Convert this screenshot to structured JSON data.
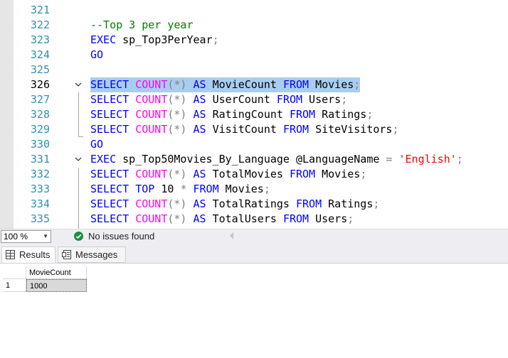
{
  "editor": {
    "lines": [
      {
        "number": "321",
        "tokens": []
      },
      {
        "number": "322",
        "tokens": [
          {
            "t": "--Top 3 per year",
            "k": "comment"
          }
        ]
      },
      {
        "number": "323",
        "tokens": [
          {
            "t": "EXEC",
            "k": "keyword"
          },
          {
            "t": " sp_Top3PerYear",
            "k": "plain"
          },
          {
            "t": ";",
            "k": "operator"
          }
        ]
      },
      {
        "number": "324",
        "tokens": [
          {
            "t": "GO",
            "k": "keyword"
          }
        ]
      },
      {
        "number": "325",
        "tokens": []
      },
      {
        "number": "326",
        "current": true,
        "highlight": true,
        "fold": "open",
        "tokens": [
          {
            "t": "SELECT",
            "k": "keyword"
          },
          {
            "t": " ",
            "k": "plain"
          },
          {
            "t": "COUNT",
            "k": "function"
          },
          {
            "t": "(*)",
            "k": "operator"
          },
          {
            "t": " ",
            "k": "plain"
          },
          {
            "t": "AS",
            "k": "keyword"
          },
          {
            "t": " MovieCount ",
            "k": "plain"
          },
          {
            "t": "FROM",
            "k": "keyword"
          },
          {
            "t": " Movies",
            "k": "plain"
          },
          {
            "t": ";",
            "k": "operator"
          }
        ]
      },
      {
        "number": "327",
        "tokens": [
          {
            "t": "SELECT",
            "k": "keyword"
          },
          {
            "t": " ",
            "k": "plain"
          },
          {
            "t": "COUNT",
            "k": "function"
          },
          {
            "t": "(*)",
            "k": "operator"
          },
          {
            "t": " ",
            "k": "plain"
          },
          {
            "t": "AS",
            "k": "keyword"
          },
          {
            "t": " UserCount ",
            "k": "plain"
          },
          {
            "t": "FROM",
            "k": "keyword"
          },
          {
            "t": " Users",
            "k": "plain"
          },
          {
            "t": ";",
            "k": "operator"
          }
        ]
      },
      {
        "number": "328",
        "tokens": [
          {
            "t": "SELECT",
            "k": "keyword"
          },
          {
            "t": " ",
            "k": "plain"
          },
          {
            "t": "COUNT",
            "k": "function"
          },
          {
            "t": "(*)",
            "k": "operator"
          },
          {
            "t": " ",
            "k": "plain"
          },
          {
            "t": "AS",
            "k": "keyword"
          },
          {
            "t": " RatingCount ",
            "k": "plain"
          },
          {
            "t": "FROM",
            "k": "keyword"
          },
          {
            "t": " Ratings",
            "k": "plain"
          },
          {
            "t": ";",
            "k": "operator"
          }
        ]
      },
      {
        "number": "329",
        "tokens": [
          {
            "t": "SELECT",
            "k": "keyword"
          },
          {
            "t": " ",
            "k": "plain"
          },
          {
            "t": "COUNT",
            "k": "function"
          },
          {
            "t": "(*)",
            "k": "operator"
          },
          {
            "t": " ",
            "k": "plain"
          },
          {
            "t": "AS",
            "k": "keyword"
          },
          {
            "t": " VisitCount ",
            "k": "plain"
          },
          {
            "t": "FROM",
            "k": "keyword"
          },
          {
            "t": " SiteVisitors",
            "k": "plain"
          },
          {
            "t": ";",
            "k": "operator"
          }
        ]
      },
      {
        "number": "330",
        "tokens": [
          {
            "t": "GO",
            "k": "keyword"
          }
        ]
      },
      {
        "number": "331",
        "fold": "open",
        "tokens": [
          {
            "t": "EXEC",
            "k": "keyword"
          },
          {
            "t": " sp_Top50Movies_By_Language @LanguageName ",
            "k": "plain"
          },
          {
            "t": "=",
            "k": "operator"
          },
          {
            "t": " ",
            "k": "plain"
          },
          {
            "t": "'English'",
            "k": "string"
          },
          {
            "t": ";",
            "k": "operator"
          }
        ]
      },
      {
        "number": "332",
        "tokens": [
          {
            "t": "SELECT",
            "k": "keyword"
          },
          {
            "t": " ",
            "k": "plain"
          },
          {
            "t": "COUNT",
            "k": "function"
          },
          {
            "t": "(*)",
            "k": "operator"
          },
          {
            "t": " ",
            "k": "plain"
          },
          {
            "t": "AS",
            "k": "keyword"
          },
          {
            "t": " TotalMovies ",
            "k": "plain"
          },
          {
            "t": "FROM",
            "k": "keyword"
          },
          {
            "t": " Movies",
            "k": "plain"
          },
          {
            "t": ";",
            "k": "operator"
          }
        ]
      },
      {
        "number": "333",
        "tokens": [
          {
            "t": "SELECT",
            "k": "keyword"
          },
          {
            "t": " ",
            "k": "plain"
          },
          {
            "t": "TOP",
            "k": "keyword"
          },
          {
            "t": " 10 ",
            "k": "plain"
          },
          {
            "t": "*",
            "k": "operator"
          },
          {
            "t": " ",
            "k": "plain"
          },
          {
            "t": "FROM",
            "k": "keyword"
          },
          {
            "t": " Movies",
            "k": "plain"
          },
          {
            "t": ";",
            "k": "operator"
          }
        ]
      },
      {
        "number": "334",
        "tokens": [
          {
            "t": "SELECT",
            "k": "keyword"
          },
          {
            "t": " ",
            "k": "plain"
          },
          {
            "t": "COUNT",
            "k": "function"
          },
          {
            "t": "(*)",
            "k": "operator"
          },
          {
            "t": " ",
            "k": "plain"
          },
          {
            "t": "AS",
            "k": "keyword"
          },
          {
            "t": " TotalRatings ",
            "k": "plain"
          },
          {
            "t": "FROM",
            "k": "keyword"
          },
          {
            "t": " Ratings",
            "k": "plain"
          },
          {
            "t": ";",
            "k": "operator"
          }
        ]
      },
      {
        "number": "335",
        "tokens": [
          {
            "t": "SELECT",
            "k": "keyword"
          },
          {
            "t": " ",
            "k": "plain"
          },
          {
            "t": "COUNT",
            "k": "function"
          },
          {
            "t": "(*)",
            "k": "operator"
          },
          {
            "t": " ",
            "k": "plain"
          },
          {
            "t": "AS",
            "k": "keyword"
          },
          {
            "t": " TotalUsers ",
            "k": "plain"
          },
          {
            "t": "FROM",
            "k": "keyword"
          },
          {
            "t": " Users",
            "k": "plain"
          },
          {
            "t": ";",
            "k": "operator"
          }
        ]
      }
    ]
  },
  "status_bar": {
    "zoom": "100 %",
    "issues_text": "No issues found",
    "issues_icon": "check-circle-icon",
    "issues_color": "#1e8e3e"
  },
  "results": {
    "tabs": [
      {
        "label": "Results",
        "icon": "grid-icon",
        "active": true
      },
      {
        "label": "Messages",
        "icon": "messages-icon",
        "active": false
      }
    ],
    "grid": {
      "columns": [
        "MovieCount"
      ],
      "rows": [
        {
          "row_number": "1",
          "cells": [
            "1000"
          ]
        }
      ]
    }
  },
  "colors": {
    "keyword": "#0000ff",
    "function": "#ff00ff",
    "comment": "#008000",
    "string": "#ff0000",
    "operator": "#808080",
    "line_number": "#2b91af",
    "selection": "#a8cdf1"
  }
}
